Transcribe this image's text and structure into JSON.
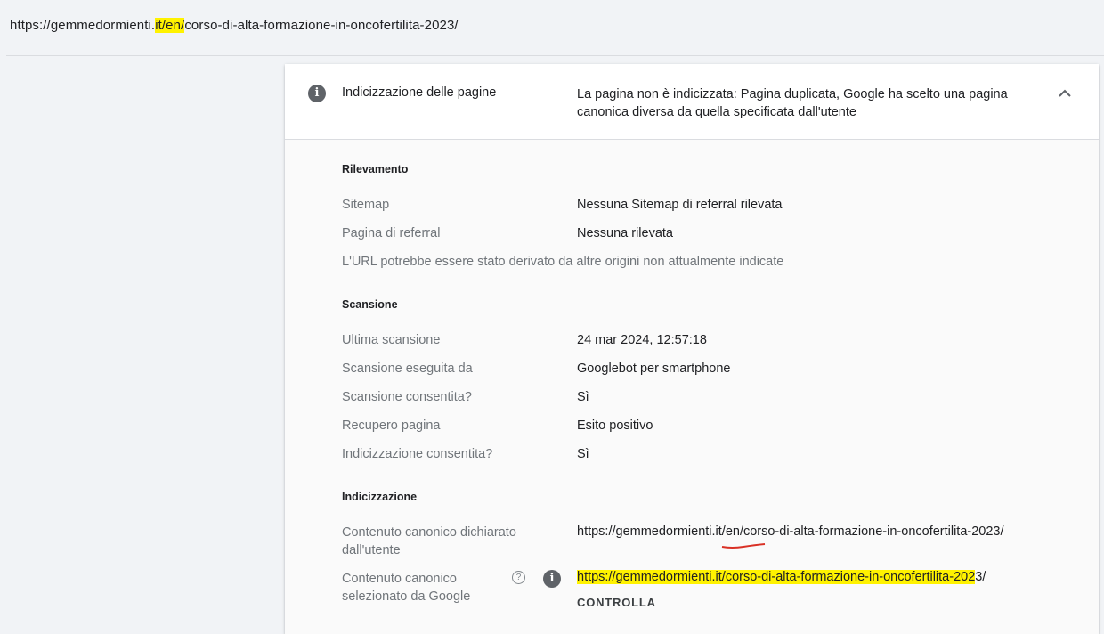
{
  "url_bar": {
    "url_prefix": "https://gemmedormienti.",
    "url_highlight": "it/en/",
    "url_suffix": "corso-di-alta-formazione-in-oncofertilita-2023/"
  },
  "header": {
    "label": "Indicizzazione delle pagine",
    "status": "La pagina non è indicizzata: Pagina duplicata, Google ha scelto una pagina canonica diversa da quella specificata dall'utente",
    "info_icon": "info-icon",
    "chevron_icon": "chevron-up-icon"
  },
  "rilevamento": {
    "title": "Rilevamento",
    "rows": [
      {
        "label": "Sitemap",
        "value": "Nessuna Sitemap di referral rilevata"
      },
      {
        "label": "Pagina di referral",
        "value": "Nessuna rilevata"
      }
    ],
    "note": "L'URL potrebbe essere stato derivato da altre origini non attualmente indicate"
  },
  "scansione": {
    "title": "Scansione",
    "rows": [
      {
        "label": "Ultima scansione",
        "value": "24 mar 2024, 12:57:18"
      },
      {
        "label": "Scansione eseguita da",
        "value": "Googlebot per smartphone"
      },
      {
        "label": "Scansione consentita?",
        "value": "Sì"
      },
      {
        "label": "Recupero pagina",
        "value": "Esito positivo"
      },
      {
        "label": "Indicizzazione consentita?",
        "value": "Sì"
      }
    ]
  },
  "indicizzazione": {
    "title": "Indicizzazione",
    "user_canonical_label_line1": "Contenuto canonico dichiarato",
    "user_canonical_label_line2": "dall'utente",
    "user_canonical_value": "https://gemmedormienti.it/en/corso-di-alta-formazione-in-oncofertilita-2023/",
    "google_canonical_label_line1": "Contenuto canonico",
    "google_canonical_label_line2": "selezionato da Google",
    "google_canonical_highlight": "https://gemmedormienti.it/corso-di-alta-formazione-in-oncofertilita-202",
    "google_canonical_rest": "3/",
    "help_icon": "help-icon",
    "help_glyph": "?",
    "info_glyph": "i",
    "check_button": "CONTROLLA"
  },
  "colors": {
    "highlight": "#fff200",
    "squiggle": "#d93025",
    "icon_gray": "#5f6368"
  }
}
